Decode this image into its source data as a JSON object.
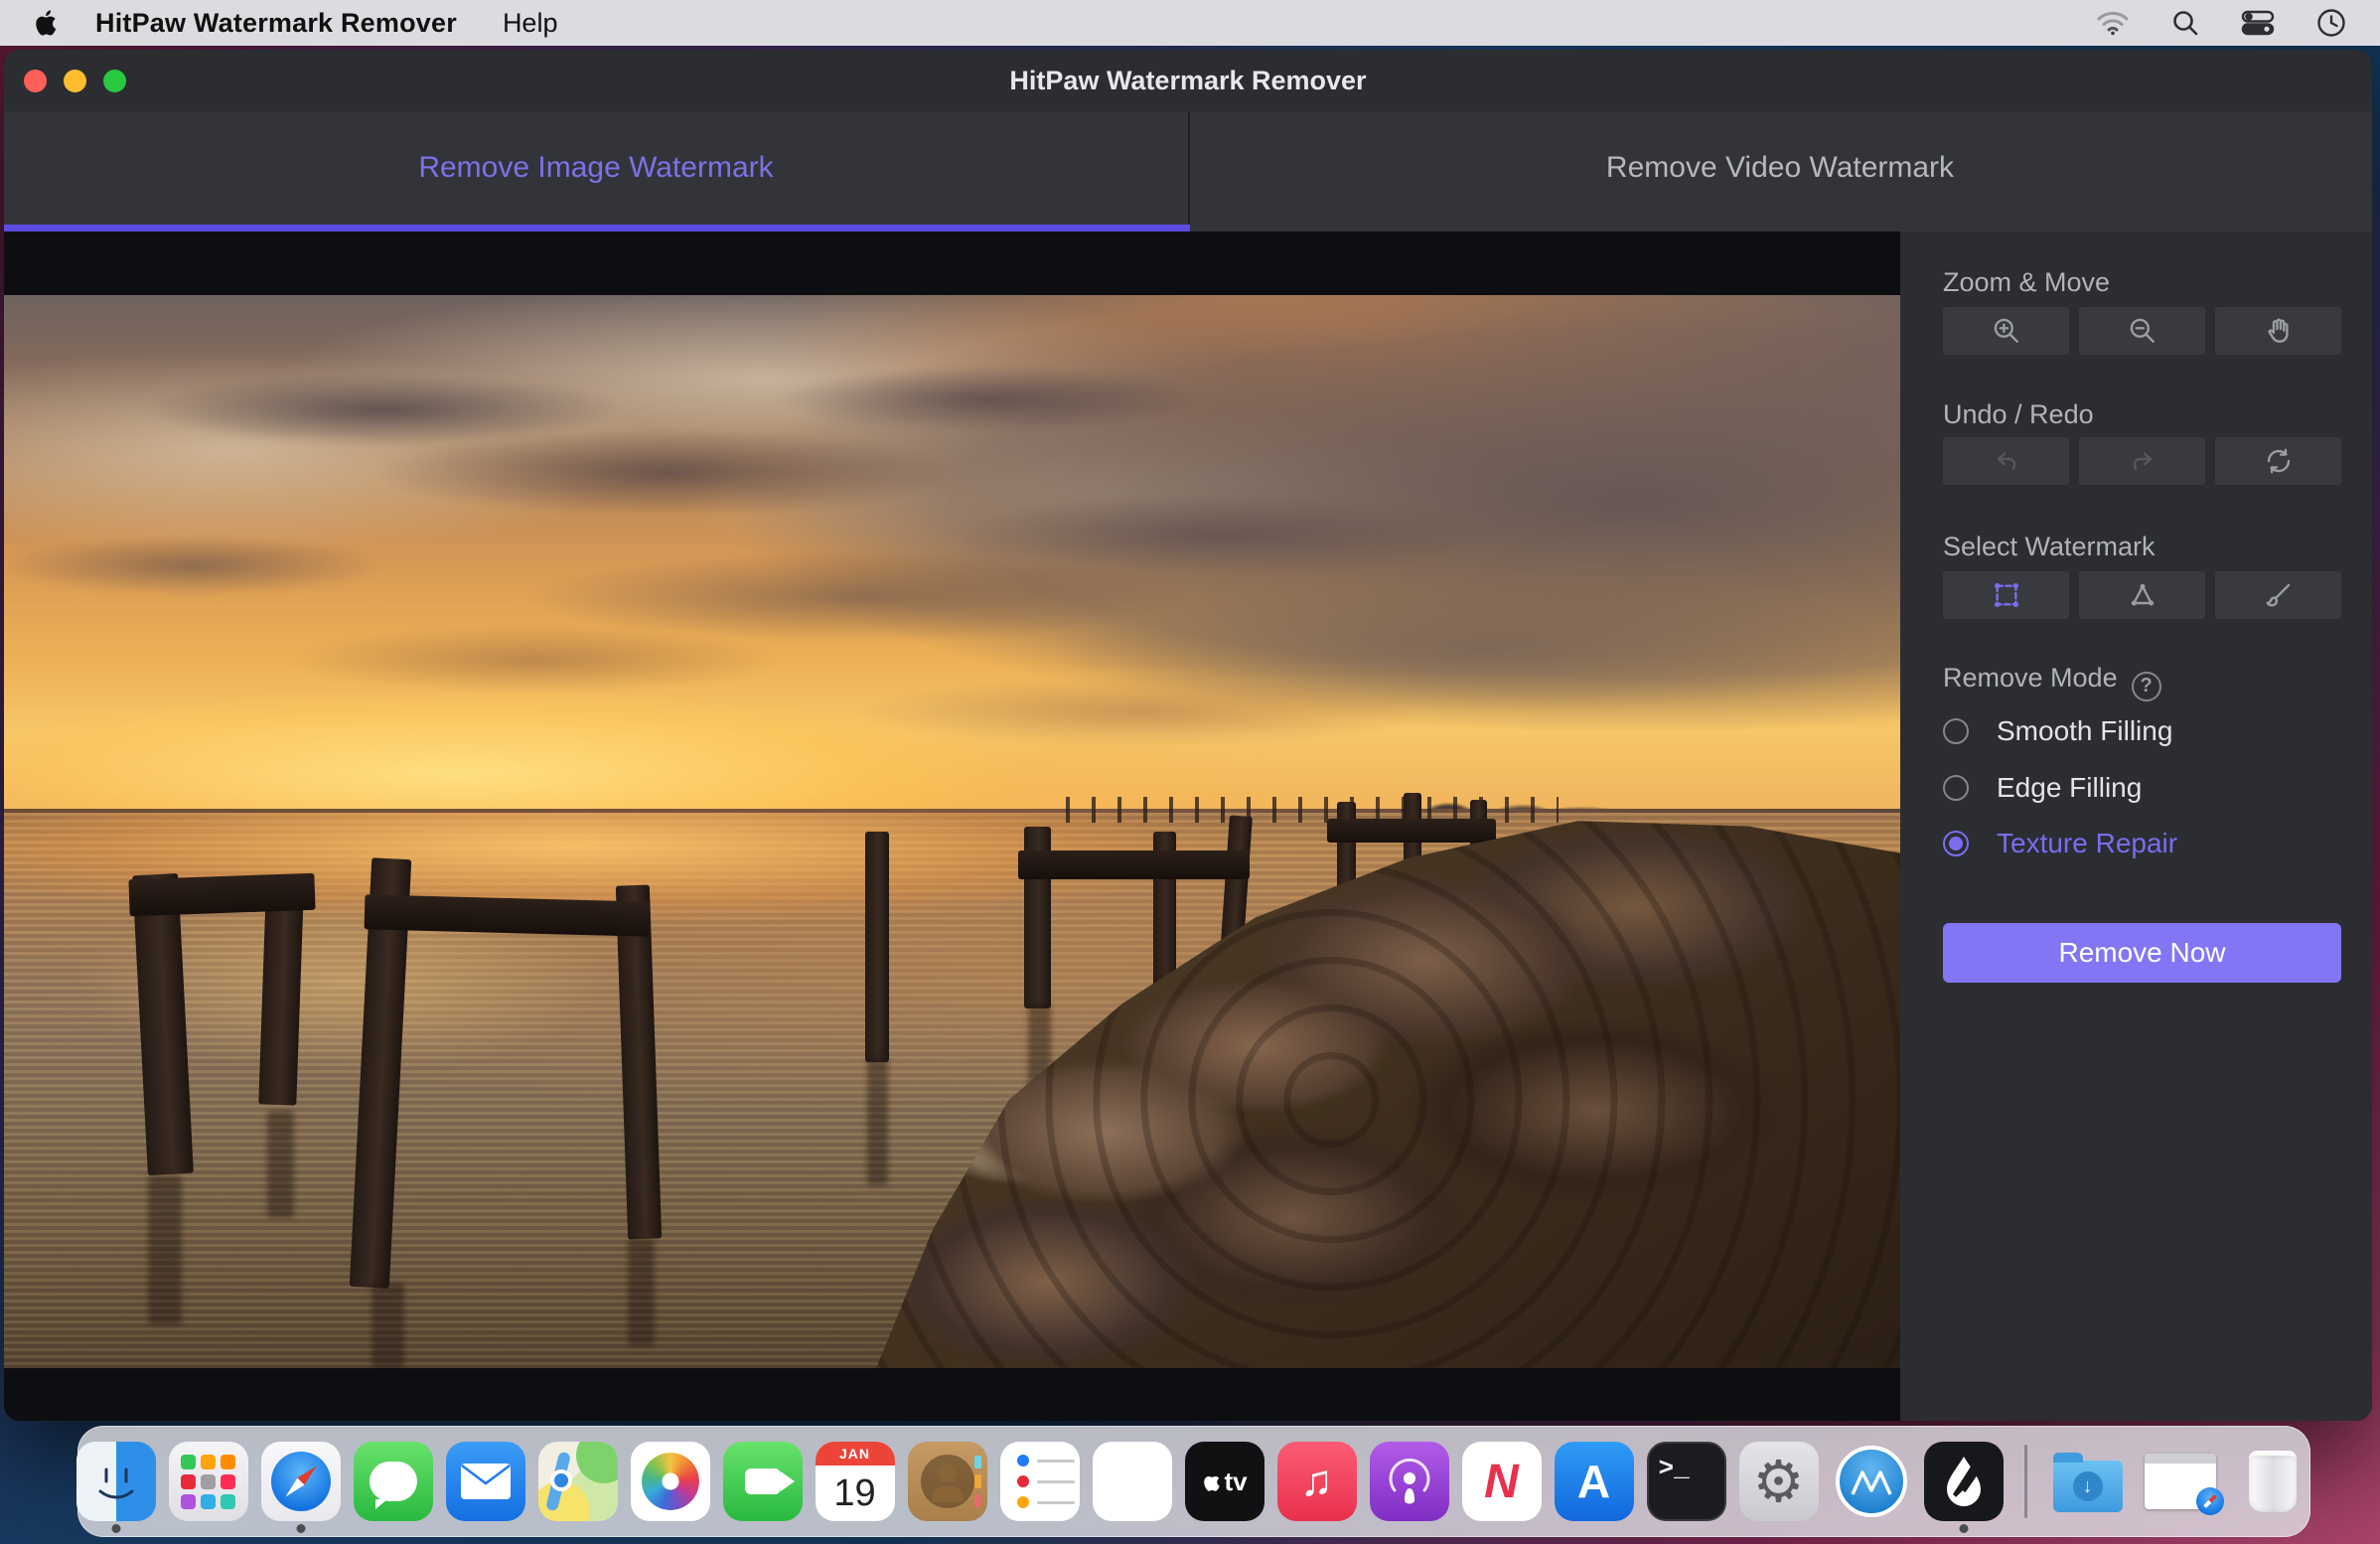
{
  "menu_bar": {
    "app_name": "HitPaw Watermark Remover",
    "menus": [
      "Help"
    ],
    "status_icons": [
      "wifi-icon",
      "spotlight-search-icon",
      "control-center-icon",
      "clock-icon"
    ]
  },
  "window": {
    "title": "HitPaw Watermark Remover",
    "traffic_lights": [
      "close",
      "minimize",
      "zoom"
    ]
  },
  "tabs": [
    {
      "label": "Remove Image Watermark",
      "active": true
    },
    {
      "label": "Remove Video Watermark",
      "active": false
    }
  ],
  "sidebar": {
    "zoom_section": {
      "title": "Zoom & Move",
      "tools": [
        "zoom-in",
        "zoom-out",
        "pan-hand"
      ]
    },
    "undo_section": {
      "title": "Undo / Redo",
      "tools": [
        "undo",
        "redo",
        "reset"
      ]
    },
    "select_section": {
      "title": "Select Watermark",
      "tools": [
        "marquee-selection",
        "polygon-selection",
        "brush-selection"
      ],
      "active_tool": "marquee-selection"
    },
    "mode_section": {
      "title": "Remove Mode",
      "help_icon": "?",
      "options": [
        {
          "label": "Smooth Filling",
          "selected": false
        },
        {
          "label": "Edge Filling",
          "selected": false
        },
        {
          "label": "Texture Repair",
          "selected": true
        }
      ]
    },
    "remove_button_label": "Remove Now"
  },
  "canvas": {
    "photo": "sunset seascape with ruined wooden pier posts and rocky breakwater"
  },
  "dock": {
    "items": [
      "Finder",
      "Launchpad",
      "Safari",
      "Messages",
      "Mail",
      "Maps",
      "Photos",
      "FaceTime",
      "Calendar",
      "Contacts",
      "Reminders",
      "Notes",
      "Apple TV",
      "Music",
      "Podcasts",
      "News",
      "App Store",
      "Terminal",
      "System Preferences",
      "App Cleaner",
      "HitPaw Watermark Remover",
      "Downloads",
      "Minimized Window",
      "Trash"
    ],
    "running_apps": [
      "Finder",
      "Safari",
      "HitPaw Watermark Remover"
    ],
    "calendar_icon": {
      "month": "JAN",
      "day": "19"
    },
    "terminal_glyph": ">_",
    "appletv_glyph": "tv",
    "news_glyph": "N",
    "appstore_glyph": "A",
    "music_glyph": "♫",
    "gear_glyph": "⚙",
    "download_arrow": "↓"
  },
  "colors": {
    "accent_purple": "#7b6cf0",
    "tab_underline": "#5c4ce0",
    "remove_button": "#8376f4",
    "sidebar_bg": "#2b2d31",
    "titlebar_bg": "#2b2d31",
    "tabbar_bg": "#323439",
    "canvas_bg": "#0d0e11",
    "menubar_bg": "#dcdce0"
  }
}
